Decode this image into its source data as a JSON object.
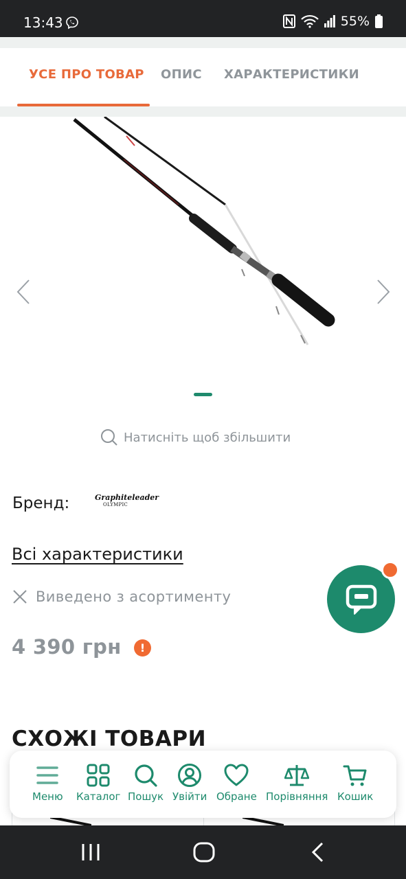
{
  "status_bar": {
    "time": "13:43",
    "battery": "55%",
    "icons": [
      "viber-icon",
      "nfc-icon",
      "wifi-icon",
      "signal-icon",
      "battery-icon"
    ]
  },
  "tabs": [
    {
      "label": "УСЕ ПРО ТОВАР",
      "active": true
    },
    {
      "label": "ОПИС",
      "active": false
    },
    {
      "label": "ХАРАКТЕРИСТИКИ",
      "active": false
    }
  ],
  "gallery": {
    "image": "fishing-rod",
    "slide": 1,
    "slides_total": 1
  },
  "zoom_hint": "Натисніть щоб збільшити",
  "brand": {
    "label": "Бренд:",
    "logo_text_1": "Graphiteleader",
    "logo_text_2": "OLYMPIC"
  },
  "all_characteristics_link": "Всі характеристики",
  "availability": "Виведено з асортименту",
  "price": "4 390 грн",
  "price_alert_mark": "!",
  "similar_title": "СХОЖІ ТОВАРИ",
  "bottom_nav": [
    {
      "label": "Меню",
      "icon": "menu-icon"
    },
    {
      "label": "Каталог",
      "icon": "catalog-icon"
    },
    {
      "label": "Пошук",
      "icon": "search-icon"
    },
    {
      "label": "Увійти",
      "icon": "user-icon"
    },
    {
      "label": "Обране",
      "icon": "heart-icon"
    },
    {
      "label": "Порівняння",
      "icon": "scales-icon"
    },
    {
      "label": "Кошик",
      "icon": "cart-icon"
    }
  ],
  "colors": {
    "accent": "#e86a3a",
    "brand_green": "#1d8a6c",
    "muted": "#8e9499",
    "alert": "#f06a32"
  }
}
